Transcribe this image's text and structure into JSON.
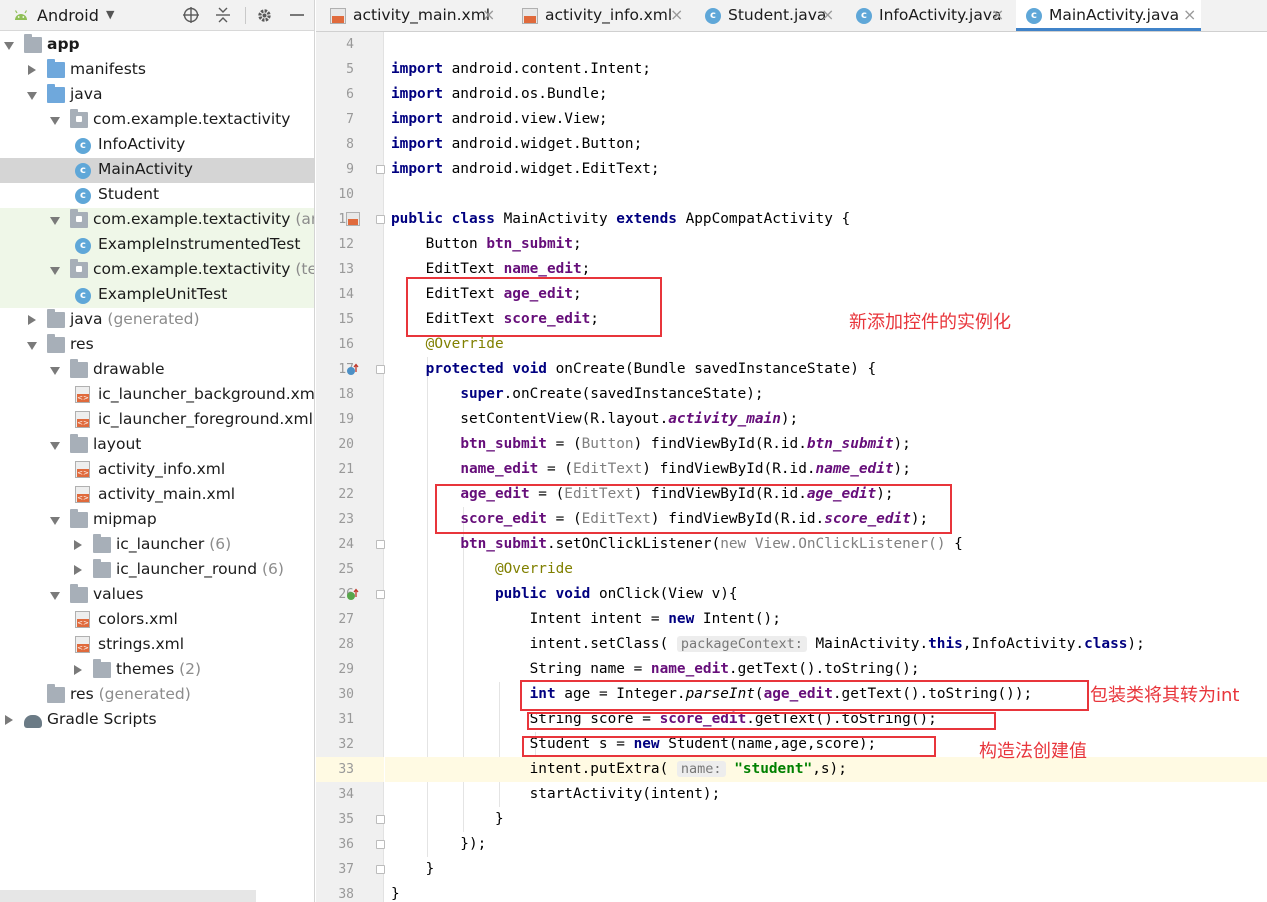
{
  "panel": {
    "view_label": "Android",
    "tree": [
      {
        "text": "app",
        "suffix": "",
        "type": "app",
        "depth": 0,
        "arrow": "down",
        "style": "bold"
      },
      {
        "text": "manifests",
        "suffix": "",
        "type": "folder-blue",
        "depth": 1,
        "arrow": "right"
      },
      {
        "text": "java",
        "suffix": "",
        "type": "folder-blue",
        "depth": 1,
        "arrow": "down"
      },
      {
        "text": "com.example.textactivity",
        "suffix": "",
        "type": "package",
        "depth": 2,
        "arrow": "down"
      },
      {
        "text": "InfoActivity",
        "suffix": "",
        "type": "class",
        "depth": 3,
        "arrow": ""
      },
      {
        "text": "MainActivity",
        "suffix": "",
        "type": "class",
        "depth": 3,
        "arrow": "",
        "state": "selected"
      },
      {
        "text": "Student",
        "suffix": "",
        "type": "class",
        "depth": 3,
        "arrow": ""
      },
      {
        "text": "com.example.textactivity",
        "suffix": " (and",
        "type": "package",
        "depth": 2,
        "arrow": "down",
        "state": "green"
      },
      {
        "text": "ExampleInstrumentedTest",
        "suffix": "",
        "type": "class",
        "depth": 3,
        "arrow": "",
        "state": "green"
      },
      {
        "text": "com.example.textactivity",
        "suffix": " (test",
        "type": "package",
        "depth": 2,
        "arrow": "down",
        "state": "green"
      },
      {
        "text": "ExampleUnitTest",
        "suffix": "",
        "type": "class",
        "depth": 3,
        "arrow": "",
        "state": "green"
      },
      {
        "text": "java",
        "suffix": " (generated)",
        "type": "folder-gray",
        "depth": 1,
        "arrow": "right"
      },
      {
        "text": "res",
        "suffix": "",
        "type": "folder-gray",
        "depth": 1,
        "arrow": "down"
      },
      {
        "text": "drawable",
        "suffix": "",
        "type": "folder-gray",
        "depth": 2,
        "arrow": "down"
      },
      {
        "text": "ic_launcher_background.xml",
        "suffix": "",
        "type": "xml",
        "depth": 3,
        "arrow": ""
      },
      {
        "text": "ic_launcher_foreground.xml",
        "suffix": "",
        "type": "xml",
        "depth": 3,
        "arrow": ""
      },
      {
        "text": "layout",
        "suffix": "",
        "type": "folder-gray",
        "depth": 2,
        "arrow": "down"
      },
      {
        "text": "activity_info.xml",
        "suffix": "",
        "type": "xml",
        "depth": 3,
        "arrow": ""
      },
      {
        "text": "activity_main.xml",
        "suffix": "",
        "type": "xml",
        "depth": 3,
        "arrow": ""
      },
      {
        "text": "mipmap",
        "suffix": "",
        "type": "folder-gray",
        "depth": 2,
        "arrow": "down"
      },
      {
        "text": "ic_launcher",
        "suffix": " (6)",
        "type": "folder-gray",
        "depth": 3,
        "arrow": "right"
      },
      {
        "text": "ic_launcher_round",
        "suffix": " (6)",
        "type": "folder-gray",
        "depth": 3,
        "arrow": "right"
      },
      {
        "text": "values",
        "suffix": "",
        "type": "folder-gray",
        "depth": 2,
        "arrow": "down"
      },
      {
        "text": "colors.xml",
        "suffix": "",
        "type": "xml",
        "depth": 3,
        "arrow": ""
      },
      {
        "text": "strings.xml",
        "suffix": "",
        "type": "xml",
        "depth": 3,
        "arrow": ""
      },
      {
        "text": "themes",
        "suffix": " (2)",
        "type": "folder-gray",
        "depth": 3,
        "arrow": "right"
      },
      {
        "text": "res",
        "suffix": " (generated)",
        "type": "folder-gray",
        "depth": 1,
        "arrow": ""
      },
      {
        "text": "Gradle Scripts",
        "suffix": "",
        "type": "gradle",
        "depth": 0,
        "arrow": "right"
      }
    ]
  },
  "tabs": [
    {
      "label": "activity_main.xml",
      "icon": "xml-file-icon",
      "active": false
    },
    {
      "label": "activity_info.xml",
      "icon": "xml-file-icon",
      "active": false
    },
    {
      "label": "Student.java",
      "icon": "class-icon",
      "active": false
    },
    {
      "label": "InfoActivity.java",
      "icon": "class-icon",
      "active": false
    },
    {
      "label": "MainActivity.java",
      "icon": "class-icon",
      "active": true
    }
  ],
  "editor": {
    "first_line": 4,
    "caret_line": 33,
    "lines": [
      {
        "n": 4,
        "code": ""
      },
      {
        "n": 5,
        "code": "[[kw:import]] android.content.Intent;"
      },
      {
        "n": 6,
        "code": "[[kw:import]] android.os.Bundle;"
      },
      {
        "n": 7,
        "code": "[[kw:import]] android.view.View;"
      },
      {
        "n": 8,
        "code": "[[kw:import]] android.widget.Button;"
      },
      {
        "n": 9,
        "code": "[[kw:import]] android.widget.EditText;"
      },
      {
        "n": 10,
        "code": ""
      },
      {
        "n": 11,
        "code": "[[kw:public]] [[kw:class]] MainActivity [[kw:extends]] AppCompatActivity {"
      },
      {
        "n": 12,
        "code": "    Button [[fld:btn_submit]];"
      },
      {
        "n": 13,
        "code": "    EditText [[fld:name_edit]];"
      },
      {
        "n": 14,
        "code": "    EditText [[fld:age_edit]];"
      },
      {
        "n": 15,
        "code": "    EditText [[fld:score_edit]];"
      },
      {
        "n": 16,
        "code": "    [[ann:@Override]]"
      },
      {
        "n": 17,
        "code": "    [[kw:protected]] [[kw:void]] onCreate(Bundle savedInstanceState) {"
      },
      {
        "n": 18,
        "code": "        [[kw:super]].onCreate(savedInstanceState);"
      },
      {
        "n": 19,
        "code": "        setContentView(R.layout.[[sfld:activity_main]]);"
      },
      {
        "n": 20,
        "code": "        [[fld:btn_submit]] = ([[cast:Button]]) findViewById(R.id.[[sfld:btn_submit]]);"
      },
      {
        "n": 21,
        "code": "        [[fld:name_edit]] = ([[cast:EditText]]) findViewById(R.id.[[sfld:name_edit]]);"
      },
      {
        "n": 22,
        "code": "        [[fld:age_edit]] = ([[cast:EditText]]) findViewById(R.id.[[sfld:age_edit]]);"
      },
      {
        "n": 23,
        "code": "        [[fld:score_edit]] = ([[cast:EditText]]) findViewById(R.id.[[sfld:score_edit]]);"
      },
      {
        "n": 24,
        "code": "        [[fld:btn_submit]].setOnClickListener([[cast:new View.OnClickListener()]] {"
      },
      {
        "n": 25,
        "code": "            [[ann:@Override]]"
      },
      {
        "n": 26,
        "code": "            [[kw:public]] [[kw:void]] onClick(View v){"
      },
      {
        "n": 27,
        "code": "                Intent intent = [[kw:new]] Intent();"
      },
      {
        "n": 28,
        "code": "                intent.setClass( [[hint:packageContext:]] MainActivity.[[kw:this]],InfoActivity.[[kw:class]]);"
      },
      {
        "n": 29,
        "code": "                String name = [[fld:name_edit]].getText().toString();"
      },
      {
        "n": 30,
        "code": "                [[kw:int]] age = Integer.[[smethod:parseInt]]([[fld:age_edit]].getText().toString());"
      },
      {
        "n": 31,
        "code": "                String score = [[fld:score_edit]].getText().toString();"
      },
      {
        "n": 32,
        "code": "                Student s = [[kw:new]] Student(name,age,score);"
      },
      {
        "n": 33,
        "code": "                intent.putExtra( [[hint:name:]] [[str:\"student\"]],s);"
      },
      {
        "n": 34,
        "code": "                startActivity(intent);"
      },
      {
        "n": 35,
        "code": "            }"
      },
      {
        "n": 36,
        "code": "        });"
      },
      {
        "n": 37,
        "code": "    }"
      },
      {
        "n": 38,
        "code": "}"
      }
    ]
  },
  "annotations": {
    "note_fields": "新添加控件的实例化",
    "note_parse": "包装类将其转为int",
    "note_constructor": "构造法创建值",
    "color": "#e8353b"
  }
}
